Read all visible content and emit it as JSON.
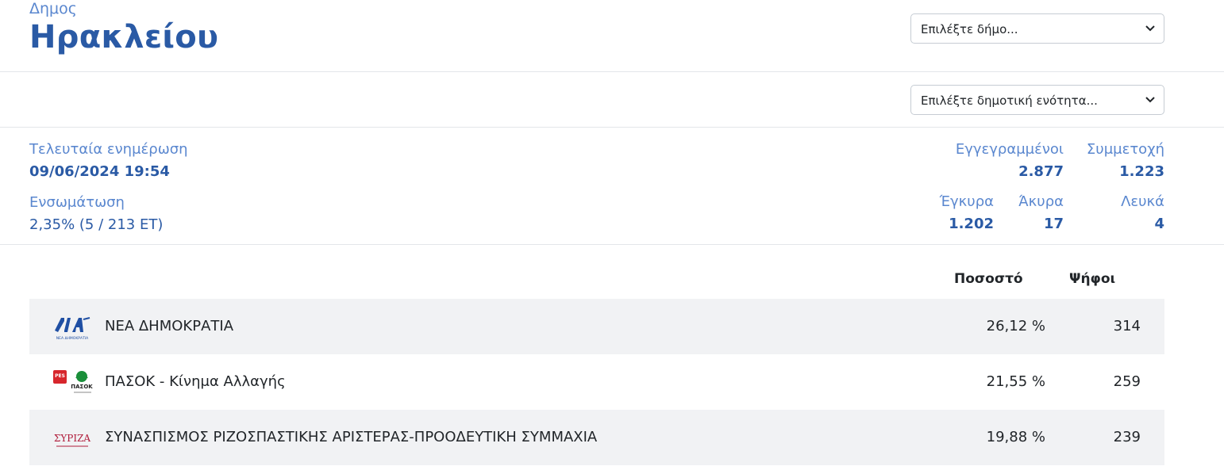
{
  "header": {
    "kicker": "Δημος",
    "title": "Ηρακλείου",
    "select_municipality": "Επιλέξτε δήμο...",
    "select_unit": "Επιλέξτε δημοτική ενότητα..."
  },
  "stats": {
    "last_update_label": "Τελευταία ενημέρωση",
    "last_update_value": "09/06/2024 19:54",
    "integration_label": "Ενσωμάτωση",
    "integration_value": "2,35% (5 / 213 ΕΤ)",
    "registered_label": "Εγγεγραμμένοι",
    "registered_value": "2.877",
    "turnout_label": "Συμμετοχή",
    "turnout_value": "1.223",
    "valid_label": "Έγκυρα",
    "valid_value": "1.202",
    "invalid_label": "Άκυρα",
    "invalid_value": "17",
    "blank_label": "Λευκά",
    "blank_value": "4"
  },
  "results": {
    "percent_header": "Ποσοστό",
    "votes_header": "Ψήφοι",
    "parties": [
      {
        "name": "ΝΕΑ ΔΗΜΟΚΡΑΤΙΑ",
        "percent": "26,12 %",
        "votes": "314",
        "logo": "nd-logo",
        "logo_text": "ΝΕΑ ΔΗΜΟΚΡΑΤΙΑ"
      },
      {
        "name": "ΠΑΣΟΚ - Κίνημα Αλλαγής",
        "percent": "21,55 %",
        "votes": "259",
        "logo": "pasok-logo",
        "logo_text": "ΠΑΣΟΚ"
      },
      {
        "name": "ΣΥΝΑΣΠΙΣΜΟΣ ΡΙΖΟΣΠΑΣΤΙΚΗΣ ΑΡΙΣΤΕΡΑΣ-ΠΡΟΟΔΕΥΤΙΚΗ ΣΥΜΜΑΧΙΑ",
        "percent": "19,88 %",
        "votes": "239",
        "logo": "syriza-logo",
        "logo_text": "ΣΥΡΙΖΑ"
      }
    ]
  },
  "colors": {
    "accent": "#2a5aa5",
    "label": "#5a87cf",
    "row_shade": "#f1f2f4"
  }
}
